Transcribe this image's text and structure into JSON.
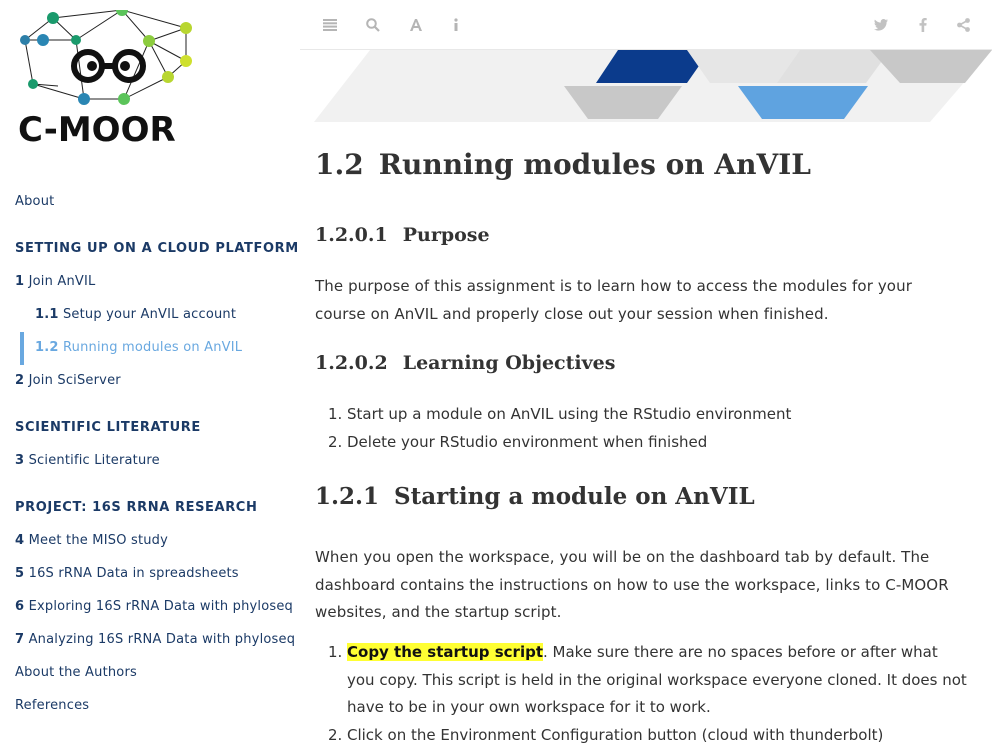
{
  "logo": {
    "text": "C-MOOR"
  },
  "sidebar": {
    "items": [
      {
        "type": "link",
        "num": "",
        "label": "About"
      },
      {
        "type": "header",
        "label": "SETTING UP ON A CLOUD PLATFORM"
      },
      {
        "type": "link",
        "num": "1",
        "label": "Join AnVIL"
      },
      {
        "type": "sub",
        "num": "1.1",
        "label": "Setup your AnVIL account"
      },
      {
        "type": "sub-active",
        "num": "1.2",
        "label": "Running modules on AnVIL"
      },
      {
        "type": "link",
        "num": "2",
        "label": "Join SciServer"
      },
      {
        "type": "header",
        "label": "SCIENTIFIC LITERATURE"
      },
      {
        "type": "link",
        "num": "3",
        "label": "Scientific Literature"
      },
      {
        "type": "header",
        "label": "PROJECT: 16S RRNA RESEARCH"
      },
      {
        "type": "link",
        "num": "4",
        "label": "Meet the MISO study"
      },
      {
        "type": "link",
        "num": "5",
        "label": "16S rRNA Data in spreadsheets"
      },
      {
        "type": "link",
        "num": "6",
        "label": "Exploring 16S rRNA Data with phyloseq"
      },
      {
        "type": "link",
        "num": "7",
        "label": "Analyzing 16S rRNA Data with phyloseq"
      },
      {
        "type": "link",
        "num": "",
        "label": "About the Authors"
      },
      {
        "type": "link",
        "num": "",
        "label": "References"
      }
    ]
  },
  "toolbar": {
    "left_icons": [
      "toc-toggle-icon",
      "search-icon",
      "font-settings-icon",
      "info-icon"
    ],
    "right_icons": [
      "twitter-icon",
      "facebook-icon",
      "share-icon"
    ]
  },
  "main": {
    "title_num": "1.2",
    "title": "Running modules on AnVIL",
    "purpose_num": "1.2.0.1",
    "purpose_title": "Purpose",
    "purpose_text": "The purpose of this assignment is to learn how to access the modules for your course on AnVIL and properly close out your session when finished.",
    "objectives_num": "1.2.0.2",
    "objectives_title": "Learning Objectives",
    "objectives": [
      "Start up a module on AnVIL using the RStudio environment",
      "Delete your RStudio environment when finished"
    ],
    "starting_num": "1.2.1",
    "starting_title": "Starting a module on AnVIL",
    "starting_text": "When you open the workspace, you will be on the dashboard tab by default. The dashboard contains the instructions on how to use the workspace, links to C-MOOR websites, and the startup script.",
    "steps": [
      {
        "highlight": "Copy the startup script",
        "text": ". Make sure there are no spaces before or after what you copy. This script is held in the original workspace everyone cloned. It does not have to be in your own workspace for it to work."
      },
      {
        "highlight": "",
        "text": "Click on the Environment Configuration button (cloud with thunderbolt)"
      }
    ]
  },
  "colors": {
    "nav_text": "#1b3a66",
    "nav_active": "#69a8e0",
    "highlight": "#ffff33",
    "banner_dark": "#0b3b8c",
    "banner_light": "#5fa3e0",
    "banner_grey": "#c8c8c8"
  }
}
